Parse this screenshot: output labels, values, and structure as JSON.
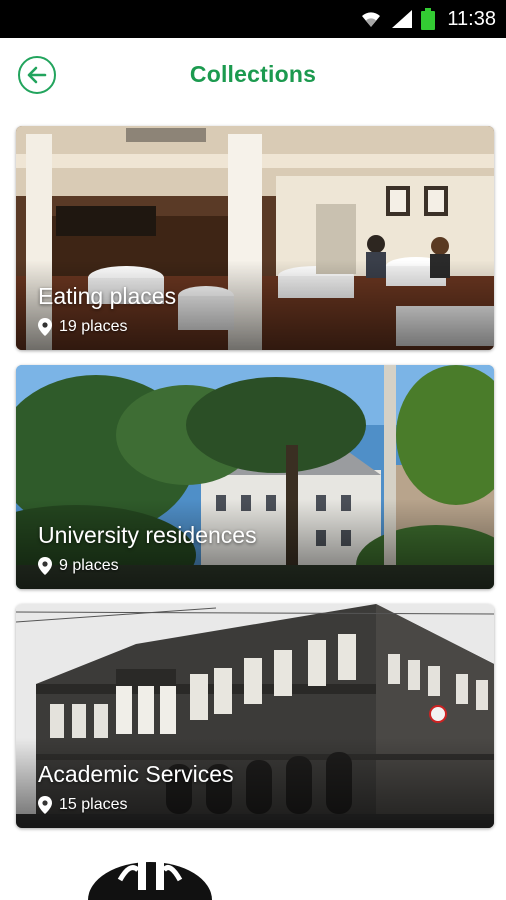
{
  "status_bar": {
    "time": "11:38",
    "icons": [
      "wifi-icon",
      "signal-icon",
      "battery-icon"
    ],
    "battery_color": "#33cc33"
  },
  "header": {
    "title": "Collections",
    "back_icon": "arrow-left-circle-icon",
    "accent_color": "#1c9a4f"
  },
  "collections": [
    {
      "name": "Eating places",
      "count_label": "19 places",
      "icon": "location-pin-icon"
    },
    {
      "name": "University residences",
      "count_label": "9 places",
      "icon": "location-pin-icon"
    },
    {
      "name": "Academic Services",
      "count_label": "15 places",
      "icon": "location-pin-icon"
    }
  ]
}
